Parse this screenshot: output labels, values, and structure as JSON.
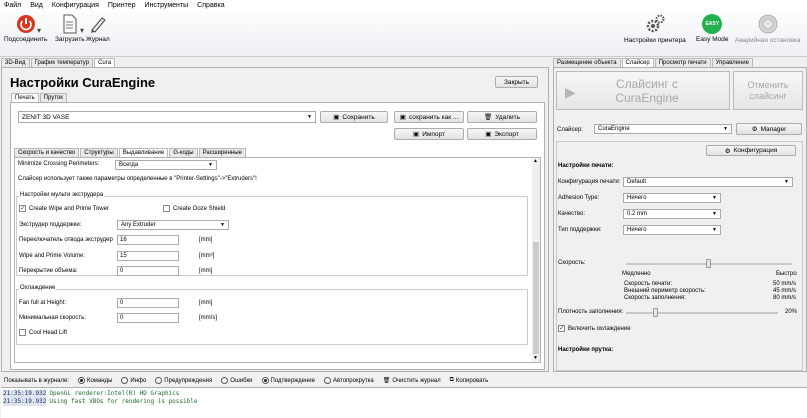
{
  "menu": [
    "Файл",
    "Вид",
    "Конфигурация",
    "Принтер",
    "Инструменты",
    "Справка"
  ],
  "toolbar": {
    "connect": "Подсоединить",
    "load": "Загрузить",
    "journal": "Журнал",
    "printer_settings": "Настройки принтера",
    "easy_mode": "Easy Mode",
    "easy_badge": "EASY",
    "emergency": "Аварийная остановка"
  },
  "left_tabs": [
    "3D-Вид",
    "График температур",
    "Cura"
  ],
  "cura": {
    "title": "Настройки CuraEngine",
    "close": "Закрыть",
    "subtabs": [
      "Печать",
      "Пруток"
    ],
    "profile": "ZENIT 3D VASE",
    "save": "Сохранить",
    "save_as": "сохранить как ...",
    "delete": "Удалить",
    "import": "Импорт",
    "export": "Экспорт",
    "inner_tabs": [
      "Скорость и качество",
      "Структуры",
      "Выдавливание",
      "G-коды",
      "Расширенные"
    ],
    "minimize_label": "Minimize Crossing Perimeters:",
    "minimize_value": "Всегда",
    "note": "Слайсер использует также параметры определенные в \"Printer-Settings\"->\"Extruders\"!",
    "multi_group": "Настройки мульти экструдера",
    "wipe_tower": "Create Wipe and Prime Tower",
    "ooze_shield": "Create Ooze Shield",
    "support_extruder_label": "Экструдер поддержки:",
    "support_extruder_value": "Any Extruder",
    "switch_label": "Переключатель отвода экструдер",
    "switch_value": "16",
    "switch_unit": "[mm]",
    "wipe_volume_label": "Wipe and Prime Volume:",
    "wipe_volume_value": "15",
    "wipe_volume_unit": "[mm³]",
    "overlap_label": "Перекрытие объема:",
    "overlap_value": "0",
    "overlap_unit": "[mm]",
    "cooling_group": "Охлаждение",
    "fan_height_label": "Fan full at Height:",
    "fan_height_value": "0",
    "fan_height_unit": "[mm]",
    "min_speed_label": "Минимальная скорость:",
    "min_speed_value": "0",
    "min_speed_unit": "[mm/s]",
    "cool_head_lift": "Cool Head Lift"
  },
  "log": {
    "show_label": "Показывать в журнале:",
    "options": [
      "Команды",
      "Инфо",
      "Предупреждения",
      "Ошибки",
      "Подтверждение",
      "Автопрокрутка"
    ],
    "clear": "Очистить журнал",
    "copy": "Копировать",
    "lines": [
      {
        "ts": "21:35:19.932",
        "msg": "OpenGL renderer:Intel(R) HD Graphics"
      },
      {
        "ts": "21:35:19.932",
        "msg": "Using fast VBOs for rendering is possible"
      }
    ]
  },
  "right_tabs": [
    "Размещение объекта",
    "Слайсер",
    "Просмотр печати",
    "Управление"
  ],
  "slicer": {
    "slice_btn_line1": "Слайсинг с",
    "slice_btn_line2": "CuraEngine",
    "cancel_line1": "Отменить",
    "cancel_line2": "слайсинг",
    "slicer_label": "Слайсер:",
    "slicer_value": "CuraEngine",
    "manager": "Manager",
    "configuration": "Конфигурация",
    "print_settings_header": "Настройки печати:",
    "print_config_label": "Конфигурация печати:",
    "print_config_value": "Default",
    "adhesion_label": "Adhesion Type:",
    "adhesion_value": "Ничего",
    "quality_label": "Качество:",
    "quality_value": "0.2 mm",
    "support_label": "Тип поддержки:",
    "support_value": "Ничего",
    "speed_label": "Скорость:",
    "speed_slow": "Медленно",
    "speed_fast": "Быстро",
    "speed_details": [
      {
        "label": "Скорость печати:",
        "value": "50 mm/s"
      },
      {
        "label": "Внешний периметр скорость:",
        "value": "45 mm/s"
      },
      {
        "label": "Скорость заполнения:",
        "value": "80 mm/s"
      }
    ],
    "infill_label": "Плотность заполнения:",
    "infill_value": "20%",
    "infill_fraction": 0.2,
    "speed_fraction": 0.5,
    "enable_cooling": "Включить охлаждение",
    "filament_header": "Настройки прутка:"
  },
  "colors": {
    "connect_red": "#d9341f",
    "easy_green": "#22b14c",
    "log_green": "#1e6b2a"
  }
}
